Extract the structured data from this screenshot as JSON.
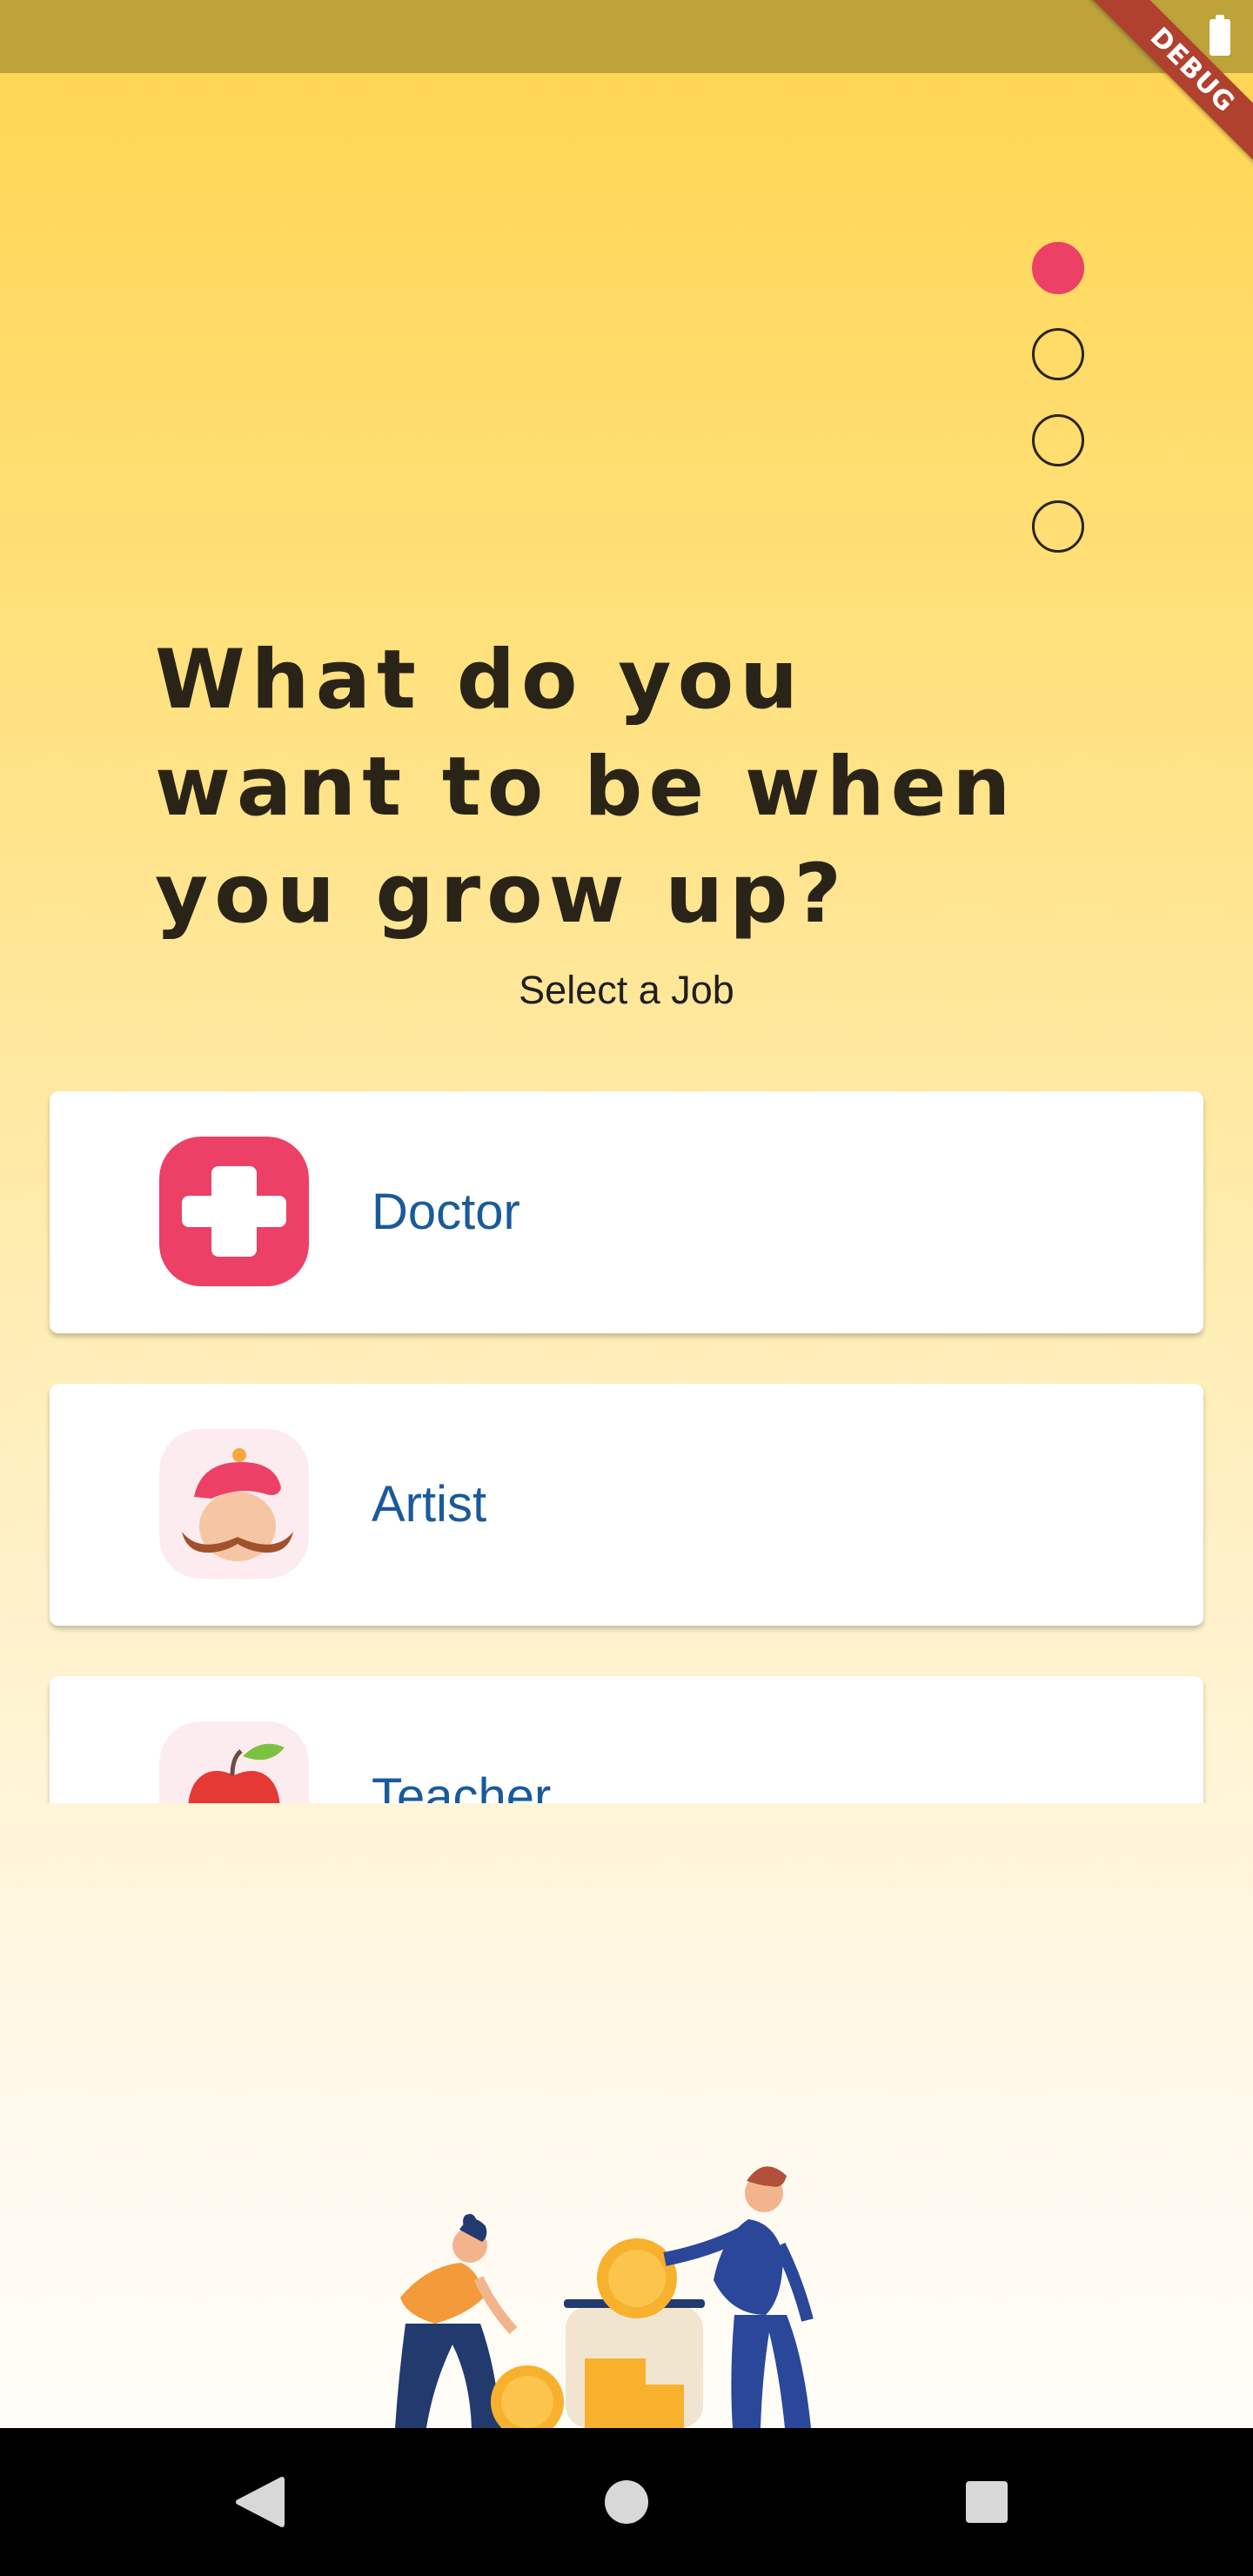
{
  "status_bar": {
    "battery_icon": "battery-full-icon",
    "debug_banner": "DEBUG"
  },
  "page_indicator": {
    "total": 4,
    "active_index": 0,
    "active_color": "#ec4066"
  },
  "headline": {
    "title": "What do you want to be when you grow up?",
    "subtitle": "Select a Job"
  },
  "jobs": [
    {
      "label": "Doctor",
      "icon": "medical-cross-icon"
    },
    {
      "label": "Artist",
      "icon": "artist-beret-mustache-icon"
    },
    {
      "label": "Teacher",
      "icon": "apple-icon"
    }
  ],
  "illustration": {
    "icon": "saving-money-jar-illustration"
  },
  "nav_bar": {
    "back_icon": "back-triangle-icon",
    "home_icon": "home-circle-icon",
    "recents_icon": "recents-square-icon"
  },
  "colors": {
    "background_top": "#ffd54f",
    "background_bottom": "#fffdf8",
    "job_label": "#1a5a9b",
    "accent": "#ec4066"
  }
}
